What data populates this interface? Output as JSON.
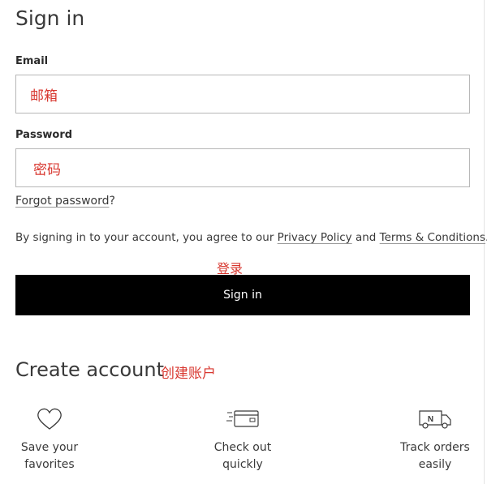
{
  "title": "Sign in",
  "email": {
    "label": "Email",
    "placeholder_annotation": "邮箱"
  },
  "password": {
    "label": "Password",
    "placeholder_annotation": "密码"
  },
  "forgot": {
    "link": "Forgot password",
    "suffix": "?"
  },
  "agreement": {
    "prefix": "By signing in to your account, you agree to our ",
    "privacy_link": "Privacy Policy",
    "middle": " and ",
    "terms_link": "Terms & Conditions",
    "suffix": "."
  },
  "signin_annotation": "登录",
  "signin_button": "Sign in",
  "create": {
    "title": "Create account",
    "annotation": "创建账户"
  },
  "benefits": [
    {
      "icon": "heart-icon",
      "line1": "Save your",
      "line2": "favorites"
    },
    {
      "icon": "credit-card-icon",
      "line1": "Check out",
      "line2": "quickly"
    },
    {
      "icon": "delivery-truck-icon",
      "line1": "Track orders",
      "line2": "easily",
      "icon_text": "N"
    }
  ],
  "colors": {
    "annotation": "#d8372f",
    "button_bg": "#000000",
    "text": "#393939"
  }
}
